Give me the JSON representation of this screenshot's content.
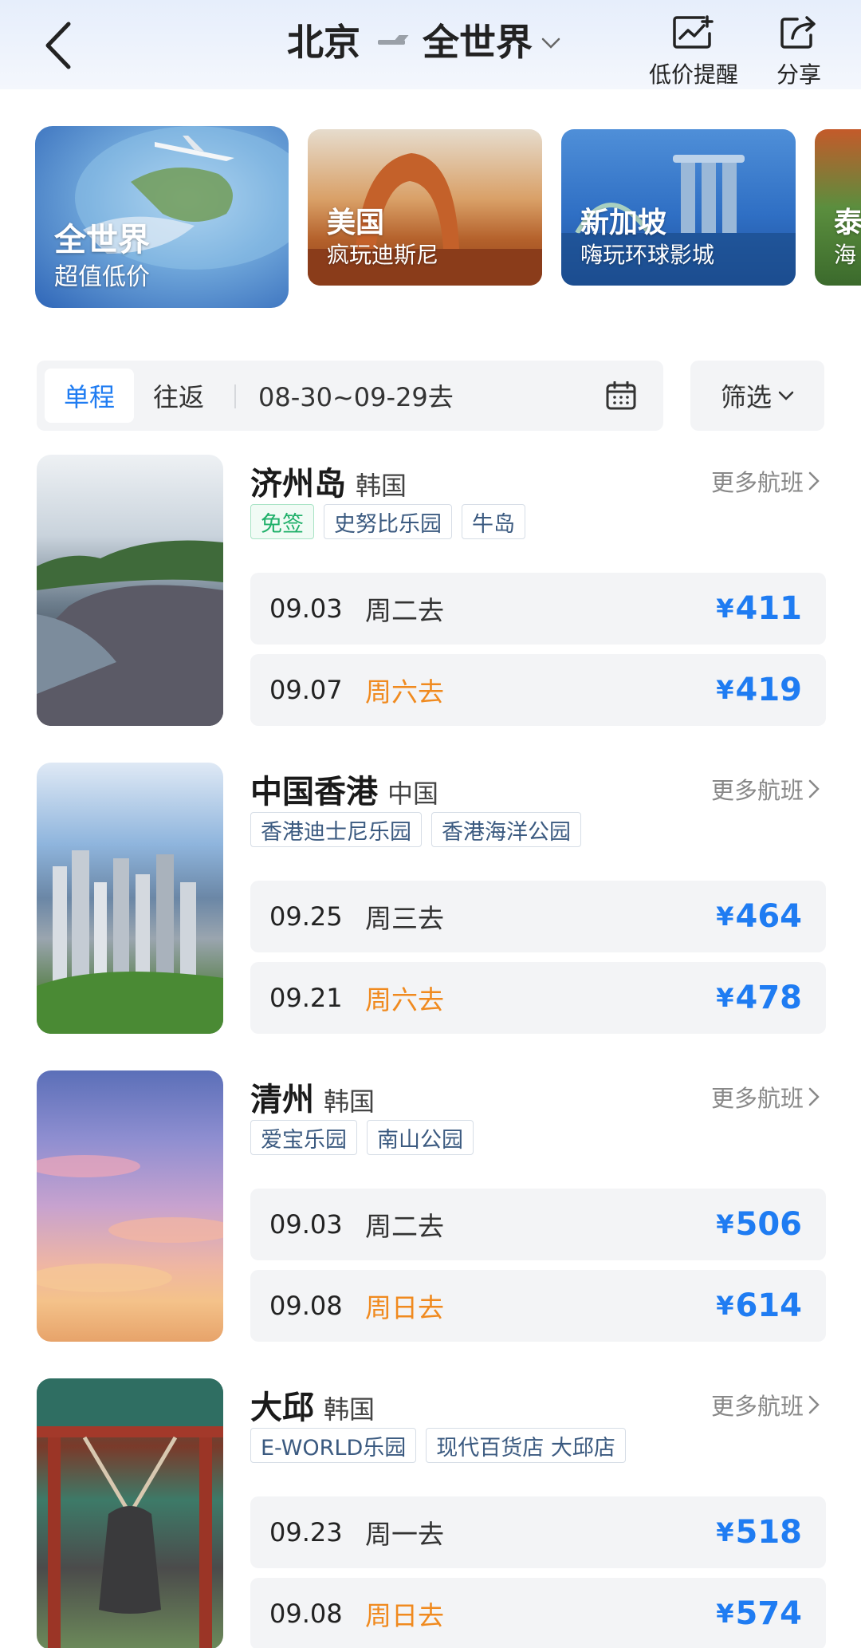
{
  "header": {
    "origin": "北京",
    "destination": "全世界",
    "price_alert_label": "低价提醒",
    "share_label": "分享"
  },
  "banners": [
    {
      "title": "全世界",
      "subtitle": "超值低价"
    },
    {
      "title": "美国",
      "subtitle": "疯玩迪斯尼"
    },
    {
      "title": "新加坡",
      "subtitle": "嗨玩环球影城"
    },
    {
      "title": "泰",
      "subtitle": "海"
    }
  ],
  "filters": {
    "one_way": "单程",
    "round_trip": "往返",
    "date_range": "08-30~09-29去",
    "filter_label": "筛选"
  },
  "more_flights_label": "更多航班",
  "currency": "¥",
  "colors": {
    "accent": "#1f7cf2",
    "weekend": "#f08a1f",
    "visa_free": "#20b06a"
  },
  "destinations": [
    {
      "city": "济州岛",
      "country": "韩国",
      "tags": [
        "免签",
        "史努比乐园",
        "牛岛"
      ],
      "flights": [
        {
          "date": "09.03",
          "weekday": "周二去",
          "price": "411"
        },
        {
          "date": "09.07",
          "weekday": "周六去",
          "price": "419"
        }
      ]
    },
    {
      "city": "中国香港",
      "country": "中国",
      "tags": [
        "香港迪士尼乐园",
        "香港海洋公园"
      ],
      "flights": [
        {
          "date": "09.25",
          "weekday": "周三去",
          "price": "464"
        },
        {
          "date": "09.21",
          "weekday": "周六去",
          "price": "478"
        }
      ]
    },
    {
      "city": "清州",
      "country": "韩国",
      "tags": [
        "爱宝乐园",
        "南山公园"
      ],
      "flights": [
        {
          "date": "09.03",
          "weekday": "周二去",
          "price": "506"
        },
        {
          "date": "09.08",
          "weekday": "周日去",
          "price": "614"
        }
      ]
    },
    {
      "city": "大邱",
      "country": "韩国",
      "tags": [
        "E-WORLD乐园",
        "现代百货店 大邱店"
      ],
      "flights": [
        {
          "date": "09.23",
          "weekday": "周一去",
          "price": "518"
        },
        {
          "date": "09.08",
          "weekday": "周日去",
          "price": "574"
        }
      ]
    }
  ]
}
